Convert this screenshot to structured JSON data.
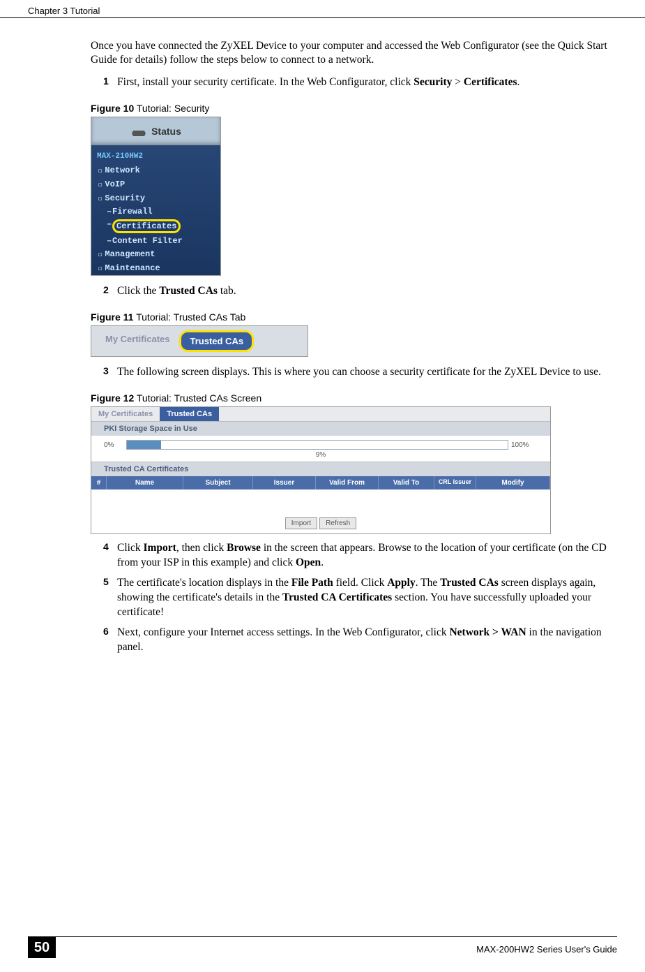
{
  "header": {
    "chapter": "Chapter 3 Tutorial"
  },
  "intro": "Once you have connected the ZyXEL Device to your computer and accessed the Web Configurator (see the Quick Start Guide for details) follow the steps below to connect to a network.",
  "steps": {
    "s1": {
      "num": "1",
      "text_before": "First, install your security certificate. In the Web Configurator, click ",
      "bold1": "Security",
      "text_mid": " > ",
      "bold2": "Certificates",
      "text_after": "."
    },
    "s2": {
      "num": "2",
      "text_before": "Click the ",
      "bold1": "Trusted CAs",
      "text_after": " tab."
    },
    "s3": {
      "num": "3",
      "text": "The following screen displays. This is where you can choose a security certificate for the ZyXEL Device to use."
    },
    "s4": {
      "num": "4",
      "p1": "Click ",
      "b1": "Import",
      "p2": ", then click ",
      "b2": "Browse",
      "p3": " in the screen that appears. Browse to the location of your certificate (on the CD from your ISP in this example) and click ",
      "b3": "Open",
      "p4": "."
    },
    "s5": {
      "num": "5",
      "p1": "The certificate's location displays in the ",
      "b1": "File Path",
      "p2": " field. Click ",
      "b2": "Apply",
      "p3": ". The ",
      "b3": "Trusted CAs",
      "p4": " screen displays again, showing the certificate's details in the ",
      "b4": "Trusted CA Certificates",
      "p5": " section. You have successfully uploaded your certificate!"
    },
    "s6": {
      "num": "6",
      "p1": "Next, configure your Internet access settings. In the Web Configurator, click ",
      "b1": "Network > WAN",
      "p2": " in the navigation panel."
    }
  },
  "figures": {
    "f10": {
      "label_num": "Figure 10",
      "label_text": "   Tutorial: Security",
      "status": "Status",
      "model": "MAX-210HW2",
      "items": {
        "network": "Network",
        "voip": "VoIP",
        "security": "Security",
        "firewall": "Firewall",
        "certificates": "Certificates",
        "contentfilter": "Content Filter",
        "management": "Management",
        "maintenance": "Maintenance"
      }
    },
    "f11": {
      "label_num": "Figure 11",
      "label_text": "   Tutorial: Trusted CAs Tab",
      "tab1": "My Certificates",
      "tab2": "Trusted CAs"
    },
    "f12": {
      "label_num": "Figure 12",
      "label_text": "   Tutorial: Trusted CAs Screen",
      "tab1": "My Certificates",
      "tab2": "Trusted CAs",
      "section1": "PKI Storage Space in Use",
      "pct_left": "0%",
      "pct_right": "100%",
      "pct_used": "9%",
      "section2": "Trusted CA Certificates",
      "columns": {
        "c1": "#",
        "c2": "Name",
        "c3": "Subject",
        "c4": "Issuer",
        "c5": "Valid From",
        "c6": "Valid To",
        "c7": "CRL Issuer",
        "c8": "Modify"
      },
      "btn1": "Import",
      "btn2": "Refresh"
    }
  },
  "footer": {
    "page": "50",
    "guide": "MAX-200HW2 Series User's Guide"
  }
}
